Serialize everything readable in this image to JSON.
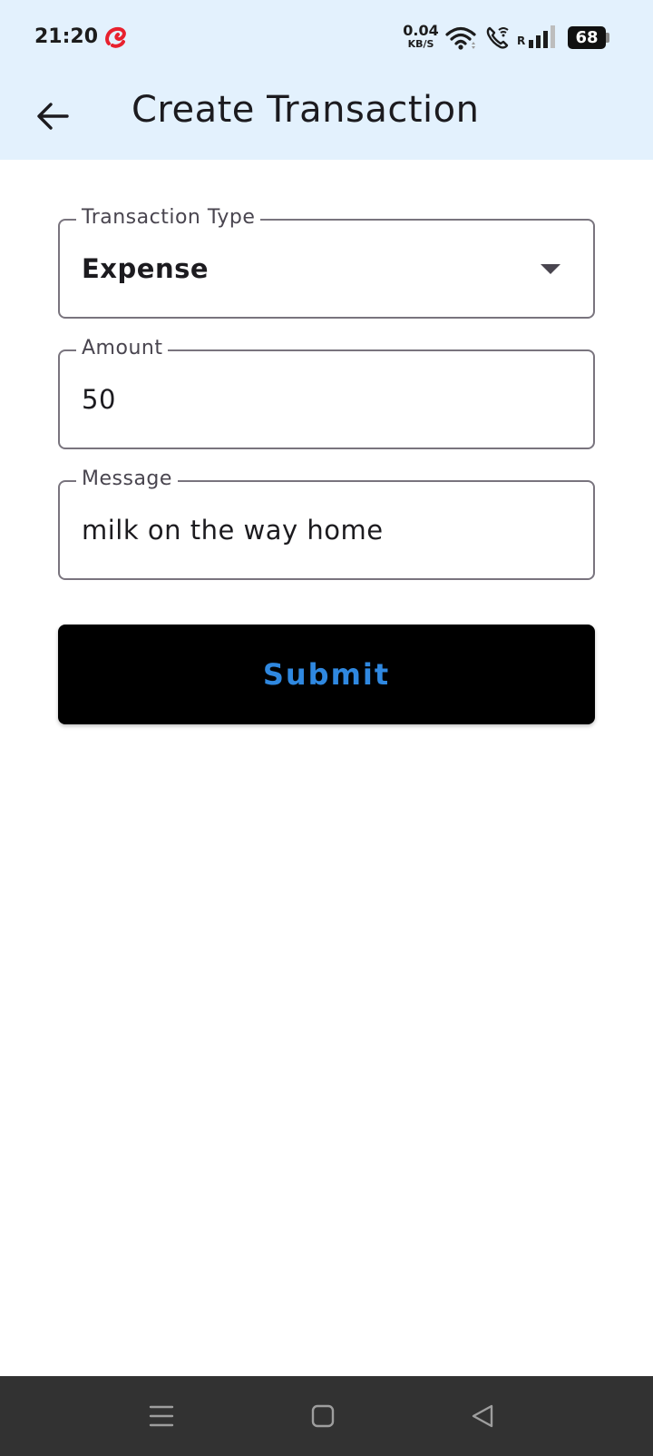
{
  "status_bar": {
    "time": "21:20",
    "net_speed_value": "0.04",
    "net_speed_unit": "KB/S",
    "roaming": "R",
    "battery_level": "68",
    "carrier_icon": "airtel-logo-icon",
    "carrier_color": "#e8212e"
  },
  "app_bar": {
    "title": "Create Transaction",
    "back_icon": "arrow-left-icon"
  },
  "form": {
    "transaction_type": {
      "label": "Transaction Type",
      "value": "Expense"
    },
    "amount": {
      "label": "Amount",
      "value": "50"
    },
    "message": {
      "label": "Message",
      "value": "milk on the way home"
    },
    "submit_label": "Submit"
  },
  "nav_bar": {
    "recents_icon": "menu-lines-icon",
    "home_icon": "square-icon",
    "back_icon": "triangle-back-icon"
  },
  "colors": {
    "header_bg": "#e3f1fd",
    "submit_bg": "#000000",
    "submit_text": "#2f88e0",
    "nav_bg": "#323232"
  }
}
